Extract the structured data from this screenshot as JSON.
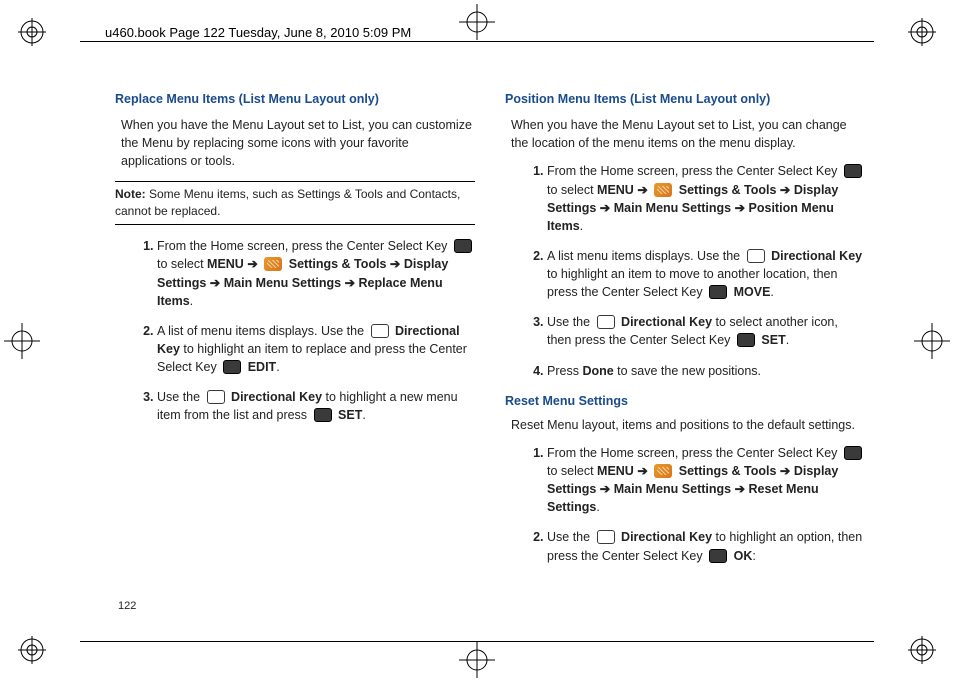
{
  "header": "u460.book  Page 122  Tuesday, June 8, 2010  5:09 PM",
  "page_number": "122",
  "left": {
    "heading": "Replace Menu Items (List Menu Layout only)",
    "intro": "When you have the Menu Layout set to List, you can customize the Menu by replacing some icons with your favorite applications or tools.",
    "note_label": "Note:",
    "note_body": " Some Menu items, such as Settings & Tools and Contacts, cannot be replaced.",
    "s1a": "From the Home screen, press the Center Select Key ",
    "s1b": " to select ",
    "menu": "MENU",
    "arr": " ➔ ",
    "settings_tools": " Settings & Tools",
    "display_settings": "Display Settings",
    "main_menu": "Main Menu Settings",
    "replace_items": "Replace Menu Items",
    "s2a": "A list of menu items displays. Use the ",
    "dirkey": "Directional Key",
    "s2b": " to highlight an item to replace and press the Center Select Key ",
    "edit": "EDIT",
    "s3a": "Use the ",
    "s3b": " to highlight a new menu item from the list and press ",
    "set": "SET"
  },
  "right": {
    "heading": "Position Menu Items (List Menu Layout only)",
    "intro": "When you have the Menu Layout set to List, you can change the location of the menu items on the menu display.",
    "s1a": "From the Home screen, press the Center Select Key ",
    "s1b": " to select ",
    "menu": "MENU",
    "arr": " ➔ ",
    "settings_tools": " Settings & Tools",
    "display_settings": "Display Settings",
    "main_menu": "Main Menu Settings",
    "position_items": "Position Menu Items",
    "s2a": "A list menu items displays. Use the ",
    "dirkey": "Directional Key",
    "s2b": " to highlight an item to move to another location, then press the Center Select Key ",
    "move": "MOVE",
    "s3a": "Use the ",
    "s3b": " to select another icon, then press the Center Select Key ",
    "set": "SET",
    "s4a": "Press ",
    "done": "Done",
    "s4b": " to save the new positions.",
    "heading2": "Reset Menu Settings",
    "intro2": "Reset Menu layout, items and positions to the default settings.",
    "r1a": "From the Home screen, press the Center Select Key ",
    "r1b": " to select ",
    "reset_items": "Reset Menu Settings",
    "r2a": "Use the ",
    "r2b": " to highlight an option, then press the Center Select Key ",
    "ok": "OK"
  }
}
